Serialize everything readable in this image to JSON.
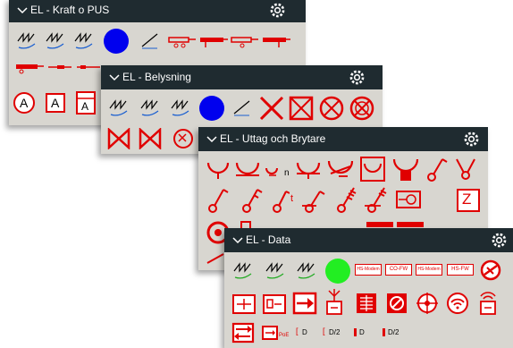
{
  "colors": {
    "titlebar": "#1f2b30",
    "panel": "#d8d6d0",
    "symbol_red": "#e00000",
    "blue": "#0000ee",
    "green": "#22ee22"
  },
  "panels": {
    "kraft": {
      "title": "EL - Kraft o PUS"
    },
    "belys": {
      "title": "EL - Belysning"
    },
    "uttag": {
      "title": "EL - Uttag och Brytare"
    },
    "data": {
      "title": "EL - Data"
    }
  },
  "icons": {
    "letter_a": "A",
    "uttag_n": "n",
    "uttag_t": "t",
    "uttag_z": "Z",
    "data_labels": [
      "HS-Modem",
      "CO-FW",
      "HS-Modem",
      "HS-FW"
    ],
    "data_poe": "PoE",
    "data_d": "D",
    "data_d2": "D/2"
  },
  "icon_names": [
    "chevron-down-icon",
    "gear-icon",
    "cable-icon",
    "circle-icon",
    "line-icon",
    "connector-icon",
    "cross-icon",
    "socket-icon",
    "switch-icon",
    "network-icon"
  ]
}
